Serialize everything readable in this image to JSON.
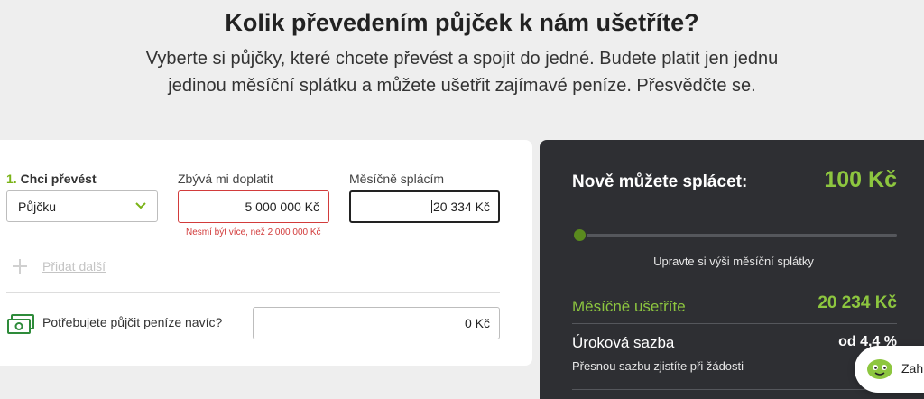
{
  "header": {
    "title": "Kolik převedením půjček k nám ušetříte?",
    "subtitle_line1": "Vyberte si půjčky, které chcete převést a spojit do jedné. Budete platit jen jednu",
    "subtitle_line2": "jedinou měsíční splátku a můžete ušetřit zajímavé peníze. Přesvědčte se."
  },
  "form": {
    "step_number": "1.",
    "transfer_label": "Chci převést",
    "transfer_selected": "Půjčku",
    "remaining_label": "Zbývá mi doplatit",
    "remaining_value": "5 000 000 Kč",
    "remaining_error": "Nesmí být více, než 2 000 000 Kč",
    "monthly_label": "Měsíčně splácím",
    "monthly_value": "20 334 Kč",
    "add_more_label": "Přidat další",
    "extra_money_label": "Potřebujete půjčit peníze navíc?",
    "extra_money_value": "0 Kč"
  },
  "summary": {
    "title": "Nově můžete splácet:",
    "amount": "100 Kč",
    "slider_hint": "Upravte si výši měsíční splátky",
    "savings_label": "Měsíčně ušetříte",
    "savings_value": "20 234 Kč",
    "rate_label": "Úroková sazba",
    "rate_value": "od 4,4 %",
    "rate_note": "Přesnou sazbu zjistíte při žádosti"
  },
  "chat": {
    "label": "Zah"
  },
  "colors": {
    "accent_green": "#8dc63f",
    "error_red": "#d23b3b",
    "dark_panel": "#2e2f33"
  }
}
